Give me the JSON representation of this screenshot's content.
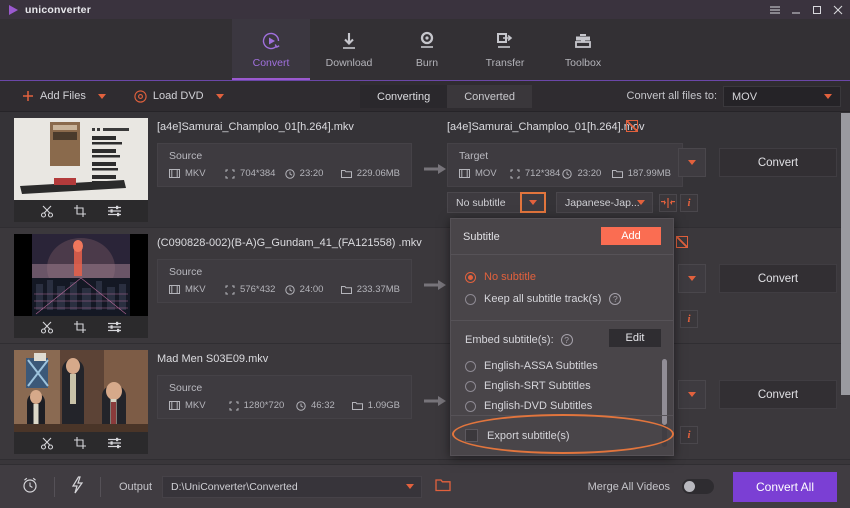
{
  "titlebar": {
    "app_name": "uniconverter",
    "menu_icon": "hamburger-icon",
    "minimize": "_",
    "maximize": "□",
    "close": "✕"
  },
  "nav": {
    "items": [
      {
        "label": "Convert",
        "icon": "convert-circle-play-icon",
        "active": true
      },
      {
        "label": "Download",
        "icon": "download-arrow-icon",
        "active": false
      },
      {
        "label": "Burn",
        "icon": "burn-disc-icon",
        "active": false
      },
      {
        "label": "Transfer",
        "icon": "transfer-device-icon",
        "active": false
      },
      {
        "label": "Toolbox",
        "icon": "toolbox-icon",
        "active": false
      }
    ],
    "active_color": "#a070dd"
  },
  "toolbar": {
    "add_files": "Add Files",
    "load_dvd": "Load DVD",
    "tabs": [
      {
        "label": "Converting",
        "active": true
      },
      {
        "label": "Converted",
        "active": false
      }
    ],
    "convert_all_to_label": "Convert all files to:",
    "format_value": "MOV"
  },
  "list": {
    "rows": [
      {
        "source_name": "[a4e]Samurai_Champloo_01[h.264].mkv",
        "target_name": "[a4e]Samurai_Champloo_01[h.264].mov",
        "source": {
          "title": "Source",
          "format": "MKV",
          "resolution": "704*384",
          "duration": "23:20",
          "size": "229.06MB"
        },
        "target": {
          "title": "Target",
          "format": "MOV",
          "resolution": "712*384",
          "duration": "23:20",
          "size": "187.99MB"
        },
        "convert_label": "Convert",
        "subtitle_value": "No subtitle",
        "language_value": "Japanese-Jap...",
        "info_label": "i"
      },
      {
        "source_name": "(C090828-002)(B-A)G_Gundam_41_(FA121558) .mkv",
        "source": {
          "title": "Source",
          "format": "MKV",
          "resolution": "576*432",
          "duration": "24:00",
          "size": "233.37MB"
        },
        "convert_label": "Convert",
        "info_label": "i"
      },
      {
        "source_name": "Mad Men S03E09.mkv",
        "source": {
          "title": "Source",
          "format": "MKV",
          "resolution": "1280*720",
          "duration": "46:32",
          "size": "1.09GB"
        },
        "convert_label": "Convert",
        "info_label": "i"
      }
    ],
    "thumb_tools": [
      "trim-scissors-icon",
      "crop-icon",
      "effect-sliders-icon"
    ]
  },
  "subtitle_dropdown": {
    "header_label": "Subtitle",
    "add_button": "Add",
    "options": [
      {
        "label": "No subtitle",
        "selected": true,
        "has_help": false
      },
      {
        "label": "Keep all subtitle track(s)",
        "selected": false,
        "has_help": true
      }
    ],
    "embed_label": "Embed subtitle(s):",
    "edit_button": "Edit",
    "embed_options": [
      {
        "label": "English-ASSA Subtitles",
        "selected": false
      },
      {
        "label": "English-SRT Subtitles",
        "selected": false
      },
      {
        "label": "English-DVD Subtitles",
        "selected": false
      }
    ],
    "export_label": "Export subtitle(s)",
    "export_checked": false,
    "highlight_color": "#e2753d",
    "accent_color": "#e2613d"
  },
  "bottom": {
    "timer_icon": "alarm-clock-icon",
    "speed_icon": "lightning-bolt-icon",
    "output_label": "Output",
    "output_path": "D:\\UniConverter\\Converted",
    "folder_icon": "open-folder-icon",
    "merge_label": "Merge All Videos",
    "merge_on": false,
    "convert_all_button": "Convert All",
    "convert_all_color": "#7b3fd4"
  }
}
